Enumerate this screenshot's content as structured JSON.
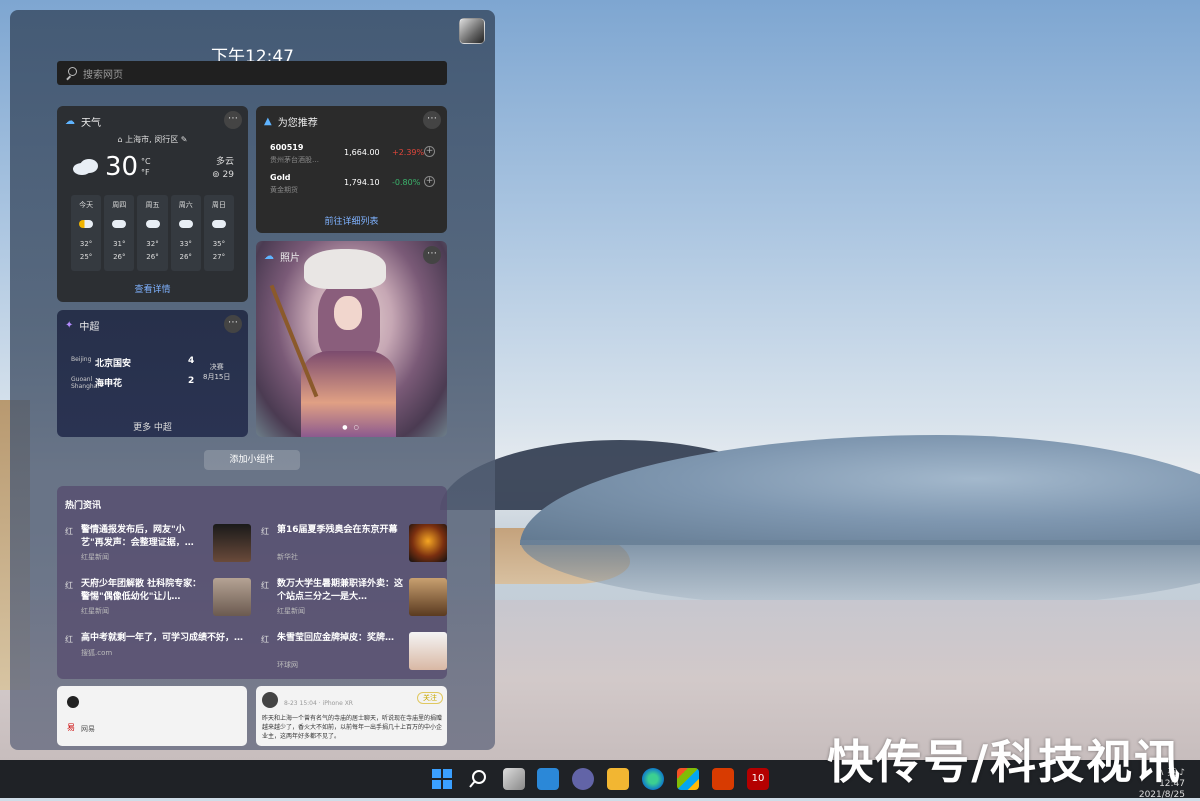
{
  "panel": {
    "time": "下午12:47",
    "search_placeholder": "搜索网页",
    "add_widgets": "添加小组件"
  },
  "weather": {
    "title": "天气",
    "location": "上海市, 闵行区",
    "temperature": "30",
    "unit_c": "°C",
    "unit_f": "°F",
    "condition": "多云",
    "aqi": "29",
    "forecast": [
      {
        "day": "今天",
        "icon": "partly-sunny",
        "high": "32°",
        "low": "25°"
      },
      {
        "day": "周四",
        "icon": "cloudy",
        "high": "31°",
        "low": "26°"
      },
      {
        "day": "周五",
        "icon": "cloudy",
        "high": "32°",
        "low": "26°"
      },
      {
        "day": "周六",
        "icon": "cloudy",
        "high": "33°",
        "low": "26°"
      },
      {
        "day": "周日",
        "icon": "cloudy",
        "high": "35°",
        "low": "27°"
      }
    ],
    "link": "查看详情"
  },
  "stocks": {
    "title": "为您推荐",
    "rows": [
      {
        "symbol": "600519",
        "name": "贵州茅台酒股…",
        "price": "1,664.00",
        "change": "+2.39%",
        "color": "#e0463b"
      },
      {
        "symbol": "Gold",
        "name": "黄金期货",
        "price": "1,794.10",
        "change": "-0.80%",
        "color": "#3bb46c"
      }
    ],
    "link": "前往详细列表"
  },
  "photos": {
    "title": "照片"
  },
  "sports": {
    "title": "中超",
    "matches": [
      {
        "logo_alt": "Beijing",
        "team": "北京国安",
        "score": "4"
      },
      {
        "logo_alt": "Guoanl Shanghai",
        "team": "海申花",
        "score": "2"
      }
    ],
    "final_label": "决赛",
    "final_date": "8月15日",
    "link": "更多 中超"
  },
  "news": {
    "title": "热门资讯",
    "items": [
      {
        "icon": "红",
        "headline": "警情通报发布后，网友\"小艺\"再发声：会整理证据，…",
        "source": "红星新闻"
      },
      {
        "icon": "红",
        "headline": "第16届夏季残奥会在东京开幕",
        "source": "新华社"
      },
      {
        "icon": "红",
        "headline": "天府少年团解散 社科院专家：警惕\"偶像低幼化\"让儿…",
        "source": "红星新闻"
      },
      {
        "icon": "红",
        "headline": "数万大学生暑期兼职译外卖：这个站点三分之一是大…",
        "source": "红星新闻"
      },
      {
        "icon": "红",
        "headline": "高中考就剩一年了，可学习成绩不好，…",
        "source": "搜狐.com"
      },
      {
        "icon": "红",
        "headline": "朱雪莹回应金牌掉皮：奖牌…",
        "source": "环球网"
      }
    ]
  },
  "mini_cards": {
    "left_text": "网易",
    "right_meta": "8-23 15:04 · iPhone XR",
    "right_follow": "关注",
    "right_body": "昨天和上海一个曾有名气的寺庙的居士聊天，听说现在寺庙里的捐赠越来越少了，香火大不如前，以前每年一出手捐几十上百万的中小企业主，这两年好多都不见了。"
  },
  "taskbar": {
    "tray_time": "12:47",
    "tray_date": "2021/8/25",
    "tray_lang": "英"
  },
  "watermark": "快传号/科技视讯"
}
